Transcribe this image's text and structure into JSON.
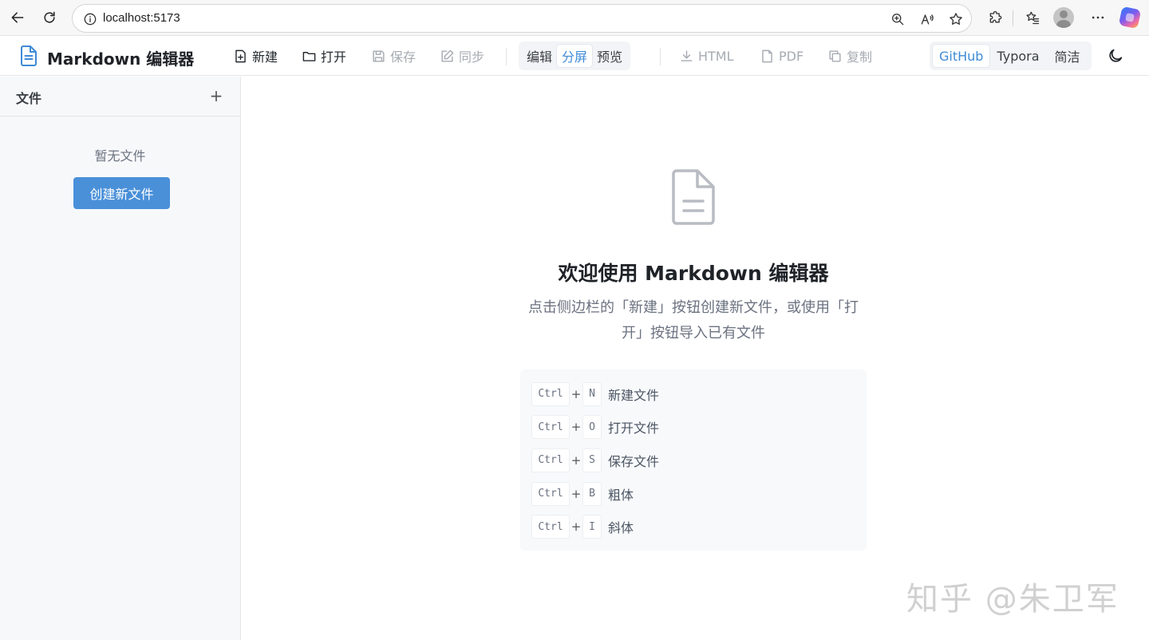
{
  "browser": {
    "url": "localhost:5173"
  },
  "app": {
    "title": "Markdown 编辑器"
  },
  "toolbar": {
    "new_label": "新建",
    "open_label": "打开",
    "save_label": "保存",
    "sync_label": "同步",
    "view_modes": [
      "编辑",
      "分屏",
      "预览"
    ],
    "active_view_mode": "分屏",
    "export_html_label": "HTML",
    "export_pdf_label": "PDF",
    "copy_label": "复制",
    "themes": [
      "GitHub",
      "Typora",
      "简洁"
    ],
    "active_theme": "GitHub"
  },
  "sidebar": {
    "title": "文件",
    "add_symbol": "+",
    "empty_text": "暂无文件",
    "create_button": "创建新文件"
  },
  "welcome": {
    "title": "欢迎使用 Markdown 编辑器",
    "description": "点击侧边栏的「新建」按钮创建新文件，或使用「打开」按钮导入已有文件",
    "shortcuts": [
      {
        "modifier": "Ctrl",
        "plus": "+",
        "key": "N",
        "label": "新建文件"
      },
      {
        "modifier": "Ctrl",
        "plus": "+",
        "key": "O",
        "label": "打开文件"
      },
      {
        "modifier": "Ctrl",
        "plus": "+",
        "key": "S",
        "label": "保存文件"
      },
      {
        "modifier": "Ctrl",
        "plus": "+",
        "key": "B",
        "label": "粗体"
      },
      {
        "modifier": "Ctrl",
        "plus": "+",
        "key": "I",
        "label": "斜体"
      }
    ]
  },
  "watermark": "知乎 @朱卫军",
  "colors": {
    "accent": "#4a90d9",
    "active_tab_text": "#3f8bd6",
    "disabled_text": "#a6abb2",
    "sidebar_bg": "#f7f8fa"
  },
  "icons": {
    "back": "arrow-left-icon",
    "reload": "reload-icon",
    "site_info": "info-icon",
    "zoom": "zoom-icon",
    "read_aloud": "read-aloud-icon",
    "favorite": "star-icon",
    "extensions": "puzzle-icon",
    "favorites_list": "favorites-icon",
    "more": "more-icon",
    "copilot": "copilot-icon",
    "logo": "document-icon",
    "theme": "moon-icon"
  }
}
